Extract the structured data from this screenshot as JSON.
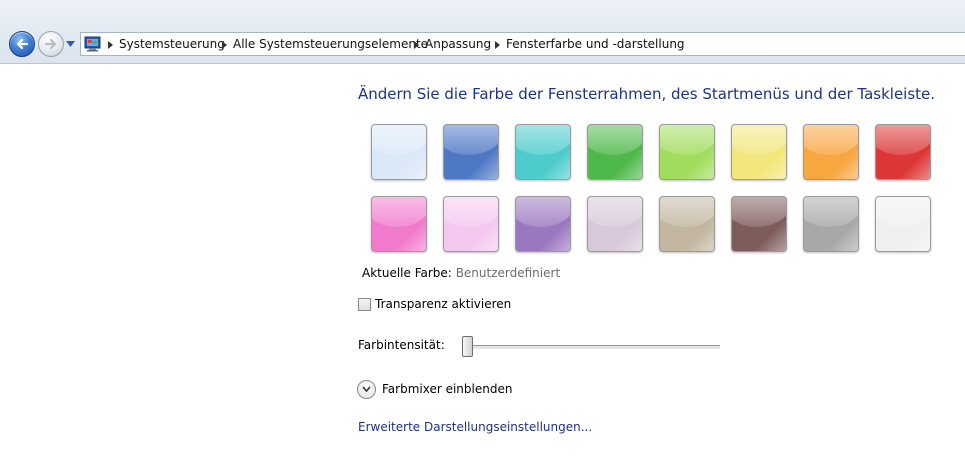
{
  "breadcrumb": {
    "items": [
      "Systemsteuerung",
      "Alle Systemsteuerungselemente",
      "Anpassung",
      "Fensterfarbe und -darstellung"
    ]
  },
  "main": {
    "heading": "Ändern Sie die Farbe der Fensterrahmen, des Startmenüs und der Taskleiste.",
    "current_color_label": "Aktuelle Farbe:",
    "current_color_value": "Benutzerdefiniert",
    "transparency_label": "Transparenz aktivieren",
    "transparency_checked": false,
    "intensity_label": "Farbintensität:",
    "intensity_value_fraction": 0.02,
    "mixer_label": "Farbmixer einblenden",
    "advanced_link": "Erweiterte Darstellungseinstellungen..."
  },
  "swatch_colors": [
    [
      "#dbe8f8",
      "#4f78c4",
      "#4ccccc",
      "#4eb94a",
      "#a2dc5c",
      "#f2e77a",
      "#f8a640",
      "#dc3636"
    ],
    [
      "#f27acc",
      "#f5c8ef",
      "#9a78c0",
      "#d9c8d9",
      "#c2b6a0",
      "#7f5c5c",
      "#a8a8a8",
      "#f0f0f0"
    ]
  ],
  "icons": {
    "back": "back-arrow-icon",
    "forward": "forward-arrow-icon",
    "history": "chevron-down-icon",
    "address": "control-panel-icon",
    "mixer": "chevron-down-icon"
  }
}
